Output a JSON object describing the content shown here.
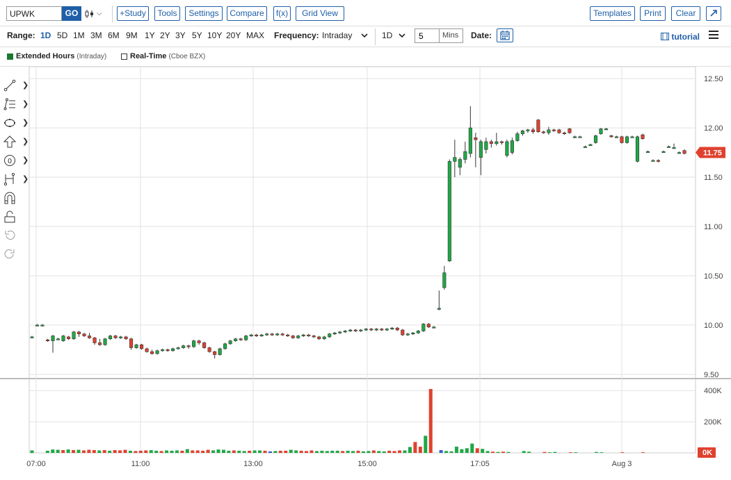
{
  "toolbar": {
    "symbol_value": "UPWK",
    "go_label": "GO",
    "chart_type_icon": "candlestick-icon",
    "study_label": "+Study",
    "tools_label": "Tools",
    "settings_label": "Settings",
    "compare_label": "Compare",
    "fx_label": "f(x)",
    "gridview_label": "Grid View",
    "templates_label": "Templates",
    "print_label": "Print",
    "clear_label": "Clear",
    "expand_icon": "expand-icon"
  },
  "range_bar": {
    "range_label": "Range:",
    "ranges": [
      "1D",
      "5D",
      "1M",
      "3M",
      "6M",
      "9M",
      "1Y",
      "2Y",
      "3Y",
      "5Y",
      "10Y",
      "20Y",
      "MAX"
    ],
    "active_range": "1D",
    "frequency_label": "Frequency:",
    "frequency_value": "Intraday",
    "interval_value": "1D",
    "minutes_value": "5",
    "minutes_unit": "Mins",
    "date_label": "Date:",
    "tutorial_label": "tutorial"
  },
  "legend": {
    "extended_label": "Extended Hours",
    "extended_sub": "(Intraday)",
    "realtime_label": "Real-Time",
    "realtime_sub": "(Cboe BZX)"
  },
  "colors": {
    "up": "#1fa846",
    "down": "#e0412f",
    "accent": "#1f5fa8",
    "last_price_tag": "#e0412f"
  },
  "chart_data": {
    "type": "candlestick",
    "price_axis_ticks": [
      "12.50",
      "12.00",
      "11.50",
      "11.00",
      "10.50",
      "10.00",
      "9.50"
    ],
    "price_ylim": [
      9.45,
      12.55
    ],
    "volume_axis_ticks": [
      "400K",
      "200K",
      "0K"
    ],
    "volume_ylim": [
      0,
      450000
    ],
    "x_tick_labels": [
      "07:00",
      "11:00",
      "13:00",
      "15:00",
      "17:05",
      "Aug 3"
    ],
    "last_price": "11.75",
    "grid": true,
    "candles": [
      [
        9.88,
        9.88,
        9.89,
        9.87,
        "u"
      ],
      [
        10.0,
        10.0,
        10.01,
        9.99,
        "u"
      ],
      [
        10.0,
        10.0,
        10.01,
        9.99,
        "u"
      ],
      [
        9.85,
        9.84,
        9.86,
        9.83,
        "d"
      ],
      [
        9.84,
        9.89,
        9.9,
        9.72,
        "u"
      ],
      [
        9.86,
        9.86,
        9.87,
        9.85,
        "u"
      ],
      [
        9.84,
        9.89,
        9.9,
        9.83,
        "u"
      ],
      [
        9.88,
        9.86,
        9.89,
        9.85,
        "d"
      ],
      [
        9.86,
        9.93,
        9.94,
        9.85,
        "u"
      ],
      [
        9.93,
        9.91,
        9.94,
        9.88,
        "d"
      ],
      [
        9.91,
        9.89,
        9.92,
        9.88,
        "d"
      ],
      [
        9.89,
        9.87,
        9.92,
        9.86,
        "d"
      ],
      [
        9.87,
        9.82,
        9.88,
        9.8,
        "d"
      ],
      [
        9.82,
        9.8,
        9.86,
        9.79,
        "d"
      ],
      [
        9.8,
        9.86,
        9.87,
        9.79,
        "u"
      ],
      [
        9.86,
        9.89,
        9.9,
        9.85,
        "u"
      ],
      [
        9.89,
        9.87,
        9.9,
        9.86,
        "d"
      ],
      [
        9.87,
        9.88,
        9.89,
        9.86,
        "u"
      ],
      [
        9.88,
        9.86,
        9.89,
        9.85,
        "d"
      ],
      [
        9.86,
        9.77,
        9.87,
        9.75,
        "d"
      ],
      [
        9.77,
        9.8,
        9.81,
        9.76,
        "u"
      ],
      [
        9.8,
        9.76,
        9.81,
        9.75,
        "d"
      ],
      [
        9.76,
        9.73,
        9.77,
        9.72,
        "d"
      ],
      [
        9.73,
        9.71,
        9.75,
        9.7,
        "d"
      ],
      [
        9.71,
        9.74,
        9.75,
        9.7,
        "u"
      ],
      [
        9.74,
        9.75,
        9.76,
        9.73,
        "u"
      ],
      [
        9.75,
        9.74,
        9.76,
        9.73,
        "d"
      ],
      [
        9.74,
        9.76,
        9.77,
        9.73,
        "u"
      ],
      [
        9.76,
        9.77,
        9.78,
        9.75,
        "u"
      ],
      [
        9.77,
        9.79,
        9.8,
        9.76,
        "u"
      ],
      [
        9.79,
        9.78,
        9.8,
        9.76,
        "d"
      ],
      [
        9.78,
        9.84,
        9.85,
        9.77,
        "u"
      ],
      [
        9.84,
        9.82,
        9.85,
        9.8,
        "d"
      ],
      [
        9.82,
        9.77,
        9.83,
        9.76,
        "d"
      ],
      [
        9.77,
        9.73,
        9.78,
        9.72,
        "d"
      ],
      [
        9.73,
        9.7,
        9.74,
        9.66,
        "d"
      ],
      [
        9.7,
        9.76,
        9.77,
        9.69,
        "u"
      ],
      [
        9.76,
        9.81,
        9.82,
        9.75,
        "u"
      ],
      [
        9.81,
        9.84,
        9.85,
        9.8,
        "u"
      ],
      [
        9.84,
        9.86,
        9.87,
        9.83,
        "u"
      ],
      [
        9.86,
        9.85,
        9.87,
        9.84,
        "d"
      ],
      [
        9.85,
        9.89,
        9.9,
        9.84,
        "u"
      ],
      [
        9.89,
        9.9,
        9.91,
        9.88,
        "u"
      ],
      [
        9.9,
        9.89,
        9.91,
        9.88,
        "d"
      ],
      [
        9.89,
        9.9,
        9.91,
        9.88,
        "u"
      ],
      [
        9.9,
        9.91,
        9.92,
        9.89,
        "u"
      ],
      [
        9.91,
        9.9,
        9.92,
        9.89,
        "d"
      ],
      [
        9.9,
        9.91,
        9.92,
        9.89,
        "u"
      ],
      [
        9.91,
        9.9,
        9.92,
        9.89,
        "d"
      ],
      [
        9.9,
        9.89,
        9.91,
        9.88,
        "d"
      ],
      [
        9.89,
        9.87,
        9.9,
        9.86,
        "d"
      ],
      [
        9.87,
        9.89,
        9.9,
        9.86,
        "u"
      ],
      [
        9.89,
        9.9,
        9.91,
        9.88,
        "u"
      ],
      [
        9.9,
        9.89,
        9.91,
        9.88,
        "d"
      ],
      [
        9.89,
        9.88,
        9.9,
        9.87,
        "d"
      ],
      [
        9.88,
        9.86,
        9.89,
        9.85,
        "d"
      ],
      [
        9.86,
        9.88,
        9.89,
        9.85,
        "u"
      ],
      [
        9.88,
        9.91,
        9.92,
        9.87,
        "u"
      ],
      [
        9.91,
        9.92,
        9.93,
        9.9,
        "u"
      ],
      [
        9.92,
        9.93,
        9.94,
        9.91,
        "u"
      ],
      [
        9.93,
        9.94,
        9.95,
        9.92,
        "u"
      ],
      [
        9.94,
        9.95,
        9.96,
        9.93,
        "u"
      ],
      [
        9.95,
        9.94,
        9.96,
        9.93,
        "d"
      ],
      [
        9.94,
        9.95,
        9.96,
        9.93,
        "u"
      ],
      [
        9.95,
        9.96,
        9.97,
        9.94,
        "u"
      ],
      [
        9.96,
        9.95,
        9.97,
        9.94,
        "d"
      ],
      [
        9.95,
        9.96,
        9.97,
        9.94,
        "u"
      ],
      [
        9.96,
        9.95,
        9.97,
        9.94,
        "d"
      ],
      [
        9.95,
        9.96,
        9.97,
        9.94,
        "u"
      ],
      [
        9.96,
        9.97,
        9.98,
        9.95,
        "u"
      ],
      [
        9.97,
        9.95,
        9.98,
        9.94,
        "d"
      ],
      [
        9.95,
        9.9,
        9.96,
        9.89,
        "d"
      ],
      [
        9.9,
        9.91,
        9.92,
        9.89,
        "u"
      ],
      [
        9.91,
        9.92,
        9.93,
        9.9,
        "u"
      ],
      [
        9.92,
        9.94,
        9.95,
        9.91,
        "u"
      ],
      [
        9.94,
        10.01,
        10.02,
        9.93,
        "u"
      ],
      [
        10.01,
        9.98,
        10.02,
        9.97,
        "d"
      ],
      [
        9.98,
        9.98,
        9.99,
        9.97,
        "u"
      ],
      [
        10.17,
        10.17,
        10.35,
        10.15,
        "u"
      ],
      [
        10.38,
        10.53,
        10.6,
        10.36,
        "u"
      ],
      [
        10.65,
        11.66,
        11.68,
        10.64,
        "u"
      ],
      [
        11.66,
        11.7,
        11.88,
        11.5,
        "u"
      ],
      [
        11.6,
        11.68,
        11.7,
        11.52,
        "u"
      ],
      [
        11.68,
        11.76,
        11.86,
        11.64,
        "u"
      ],
      [
        11.74,
        12.0,
        12.22,
        11.7,
        "u"
      ],
      [
        11.9,
        11.88,
        11.95,
        11.6,
        "d"
      ],
      [
        11.7,
        11.86,
        11.88,
        11.52,
        "u"
      ],
      [
        11.78,
        11.86,
        11.9,
        11.74,
        "u"
      ],
      [
        11.86,
        11.84,
        11.88,
        11.8,
        "d"
      ],
      [
        11.84,
        11.86,
        11.95,
        11.82,
        "u"
      ],
      [
        11.86,
        11.85,
        11.87,
        11.83,
        "d"
      ],
      [
        11.72,
        11.86,
        11.88,
        11.7,
        "u"
      ],
      [
        11.75,
        11.87,
        11.9,
        11.73,
        "u"
      ],
      [
        11.87,
        11.94,
        11.96,
        11.86,
        "u"
      ],
      [
        11.94,
        11.97,
        11.98,
        11.92,
        "u"
      ],
      [
        11.97,
        11.98,
        11.99,
        11.95,
        "u"
      ],
      [
        11.98,
        11.96,
        12.0,
        11.94,
        "d"
      ],
      [
        12.08,
        11.96,
        12.09,
        11.95,
        "d"
      ],
      [
        11.96,
        11.95,
        11.97,
        11.94,
        "d"
      ],
      [
        11.95,
        11.98,
        12.01,
        11.93,
        "u"
      ],
      [
        11.98,
        11.97,
        11.99,
        11.96,
        "d"
      ],
      [
        11.98,
        11.95,
        11.99,
        11.94,
        "d"
      ],
      [
        11.95,
        11.94,
        11.96,
        11.93,
        "d"
      ],
      [
        11.99,
        11.95,
        12.0,
        11.94,
        "d"
      ],
      [
        11.91,
        11.91,
        11.92,
        11.9,
        "u"
      ],
      [
        11.91,
        11.91,
        11.92,
        11.9,
        "u"
      ],
      [
        11.81,
        11.81,
        11.82,
        11.8,
        "u"
      ],
      [
        11.83,
        11.83,
        11.84,
        11.82,
        "u"
      ],
      [
        11.85,
        11.92,
        11.93,
        11.84,
        "u"
      ],
      [
        11.94,
        11.99,
        12.0,
        11.93,
        "u"
      ],
      [
        11.99,
        11.99,
        12.0,
        11.98,
        "u"
      ],
      [
        11.92,
        11.91,
        11.93,
        11.9,
        "d"
      ],
      [
        11.91,
        11.91,
        11.92,
        11.9,
        "u"
      ],
      [
        11.91,
        11.85,
        11.92,
        11.84,
        "d"
      ],
      [
        11.85,
        11.91,
        11.92,
        11.84,
        "u"
      ],
      [
        11.91,
        11.91,
        11.92,
        11.9,
        "u"
      ],
      [
        11.66,
        11.91,
        11.92,
        11.65,
        "u"
      ],
      [
        11.93,
        11.89,
        11.94,
        11.88,
        "d"
      ],
      [
        11.76,
        11.76,
        11.77,
        11.75,
        "u"
      ],
      [
        11.67,
        11.67,
        11.68,
        11.66,
        "u"
      ],
      [
        11.67,
        11.66,
        11.68,
        11.65,
        "d"
      ],
      [
        11.76,
        11.76,
        11.77,
        11.75,
        "u"
      ],
      [
        11.81,
        11.81,
        11.82,
        11.8,
        "u"
      ],
      [
        11.8,
        11.8,
        11.84,
        11.79,
        "u"
      ],
      [
        11.75,
        11.75,
        11.76,
        11.74,
        "u"
      ],
      [
        11.77,
        11.74,
        11.78,
        11.73,
        "d"
      ]
    ],
    "volumes": [
      [
        16000,
        "u"
      ],
      [
        0,
        "u"
      ],
      [
        0,
        "u"
      ],
      [
        14000,
        "u"
      ],
      [
        22000,
        "u"
      ],
      [
        20000,
        "u"
      ],
      [
        18000,
        "d"
      ],
      [
        22000,
        "u"
      ],
      [
        18000,
        "d"
      ],
      [
        20000,
        "u"
      ],
      [
        16000,
        "d"
      ],
      [
        20000,
        "d"
      ],
      [
        18000,
        "d"
      ],
      [
        16000,
        "u"
      ],
      [
        18000,
        "d"
      ],
      [
        14000,
        "u"
      ],
      [
        18000,
        "d"
      ],
      [
        16000,
        "d"
      ],
      [
        20000,
        "d"
      ],
      [
        14000,
        "u"
      ],
      [
        12000,
        "d"
      ],
      [
        14000,
        "d"
      ],
      [
        16000,
        "d"
      ],
      [
        18000,
        "u"
      ],
      [
        14000,
        "u"
      ],
      [
        12000,
        "d"
      ],
      [
        16000,
        "u"
      ],
      [
        14000,
        "u"
      ],
      [
        16000,
        "u"
      ],
      [
        14000,
        "d"
      ],
      [
        24000,
        "u"
      ],
      [
        16000,
        "d"
      ],
      [
        16000,
        "d"
      ],
      [
        14000,
        "d"
      ],
      [
        20000,
        "d"
      ],
      [
        16000,
        "u"
      ],
      [
        22000,
        "u"
      ],
      [
        20000,
        "u"
      ],
      [
        14000,
        "u"
      ],
      [
        16000,
        "d"
      ],
      [
        14000,
        "u"
      ],
      [
        12000,
        "u"
      ],
      [
        14000,
        "d"
      ],
      [
        16000,
        "u"
      ],
      [
        16000,
        "u"
      ],
      [
        14000,
        "d"
      ],
      [
        10000,
        "b"
      ],
      [
        12000,
        "u"
      ],
      [
        14000,
        "d"
      ],
      [
        14000,
        "d"
      ],
      [
        20000,
        "u"
      ],
      [
        16000,
        "u"
      ],
      [
        14000,
        "d"
      ],
      [
        12000,
        "d"
      ],
      [
        16000,
        "d"
      ],
      [
        12000,
        "u"
      ],
      [
        14000,
        "u"
      ],
      [
        12000,
        "u"
      ],
      [
        14000,
        "u"
      ],
      [
        14000,
        "u"
      ],
      [
        12000,
        "d"
      ],
      [
        14000,
        "u"
      ],
      [
        12000,
        "u"
      ],
      [
        14000,
        "d"
      ],
      [
        10000,
        "u"
      ],
      [
        12000,
        "u"
      ],
      [
        16000,
        "d"
      ],
      [
        12000,
        "u"
      ],
      [
        10000,
        "u"
      ],
      [
        14000,
        "d"
      ],
      [
        12000,
        "d"
      ],
      [
        16000,
        "d"
      ],
      [
        16000,
        "u"
      ],
      [
        38000,
        "u"
      ],
      [
        70000,
        "d"
      ],
      [
        40000,
        "d"
      ],
      [
        110000,
        "u"
      ],
      [
        410000,
        "d"
      ],
      [
        0,
        "u"
      ],
      [
        18000,
        "b"
      ],
      [
        12000,
        "u"
      ],
      [
        10000,
        "u"
      ],
      [
        40000,
        "u"
      ],
      [
        24000,
        "u"
      ],
      [
        30000,
        "u"
      ],
      [
        60000,
        "u"
      ],
      [
        30000,
        "d"
      ],
      [
        26000,
        "u"
      ],
      [
        12000,
        "u"
      ],
      [
        8000,
        "d"
      ],
      [
        6000,
        "u"
      ],
      [
        8000,
        "d"
      ],
      [
        6000,
        "u"
      ],
      [
        0,
        "u"
      ],
      [
        0,
        "u"
      ],
      [
        12000,
        "u"
      ],
      [
        8000,
        "u"
      ],
      [
        0,
        "u"
      ],
      [
        0,
        "d"
      ],
      [
        6000,
        "d"
      ],
      [
        4000,
        "u"
      ],
      [
        6000,
        "u"
      ],
      [
        0,
        "d"
      ],
      [
        0,
        "d"
      ],
      [
        4000,
        "d"
      ],
      [
        4000,
        "u"
      ],
      [
        0,
        "u"
      ],
      [
        0,
        "u"
      ],
      [
        0,
        "u"
      ],
      [
        6000,
        "u"
      ],
      [
        4000,
        "u"
      ],
      [
        0,
        "u"
      ],
      [
        0,
        "d"
      ],
      [
        0,
        "u"
      ],
      [
        4000,
        "d"
      ],
      [
        0,
        "u"
      ],
      [
        0,
        "u"
      ],
      [
        0,
        "u"
      ],
      [
        4000,
        "d"
      ],
      [
        0,
        "u"
      ],
      [
        0,
        "u"
      ],
      [
        0,
        "d"
      ],
      [
        0,
        "u"
      ],
      [
        0,
        "u"
      ],
      [
        0,
        "u"
      ],
      [
        0,
        "u"
      ],
      [
        0,
        "d"
      ]
    ]
  }
}
